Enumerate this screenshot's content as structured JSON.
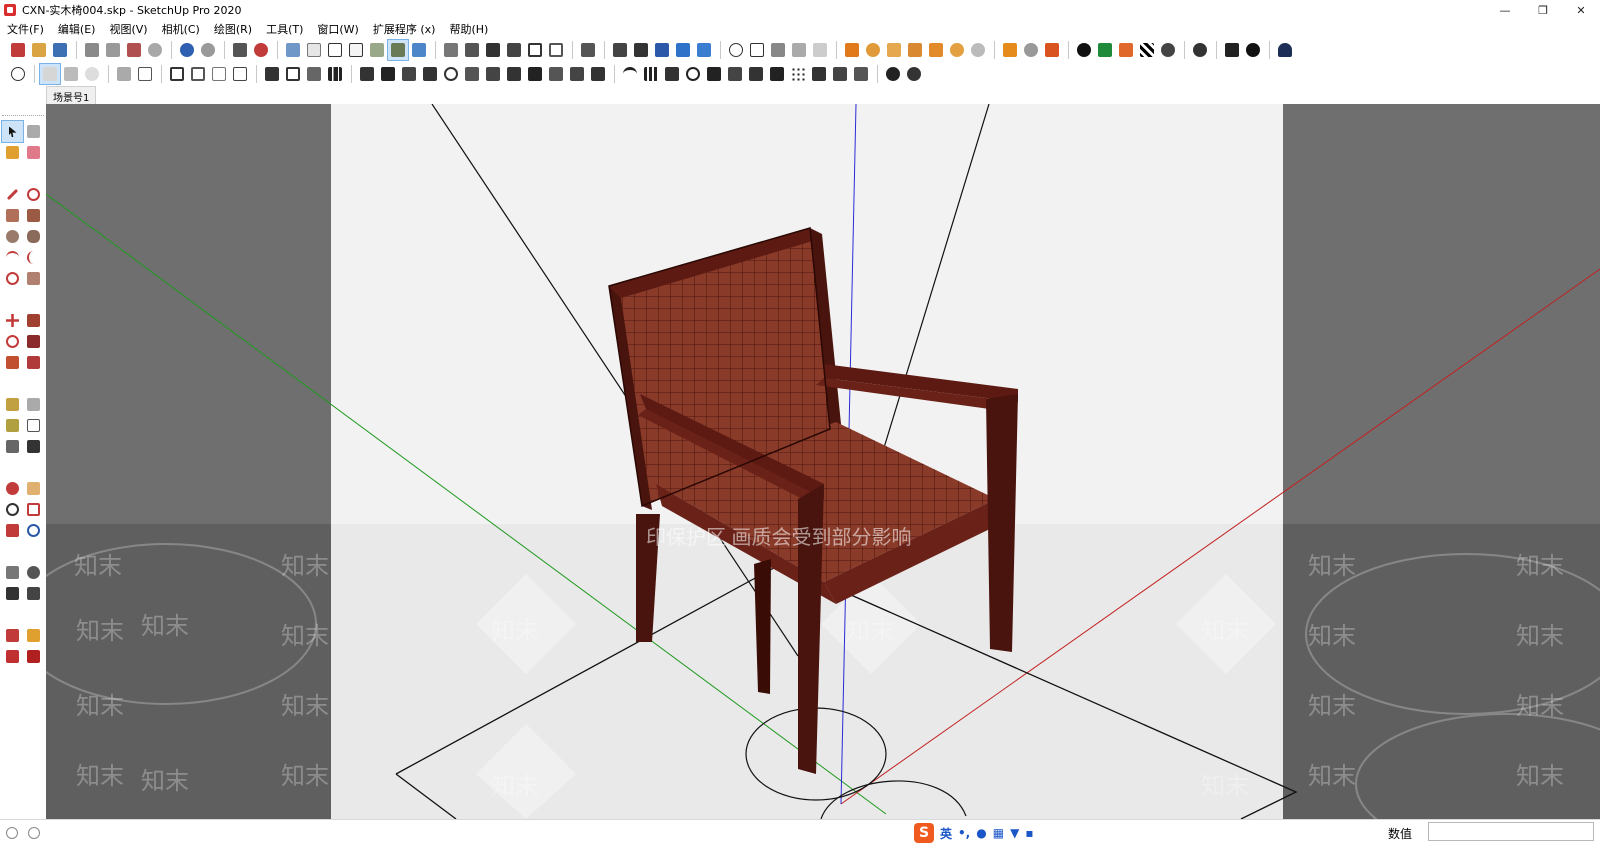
{
  "window": {
    "title": "CXN-实木椅004.skp - SketchUp Pro 2020",
    "minimize_glyph": "—",
    "maximize_glyph": "❐",
    "close_glyph": "✕"
  },
  "menu": [
    "文件(F)",
    "编辑(E)",
    "视图(V)",
    "相机(C)",
    "绘图(R)",
    "工具(T)",
    "窗口(W)",
    "扩展程序 (x)",
    "帮助(H)"
  ],
  "scene_tabs": [
    "场景号1"
  ],
  "watermark": {
    "banner": "印保护区  画质会受到部分影响",
    "brand": "知末"
  },
  "status": {
    "ime_logo": "S",
    "ime_lang": "英",
    "value_label": "数值",
    "value_input": ""
  },
  "colors": {
    "sky": "#f2f2f2",
    "ground": "#e9e9e9",
    "outside": "#6f6f6f",
    "chair_fabric": "#8a3a28",
    "chair_wood": "#5c1a12",
    "axis_red": "#c22020",
    "axis_green": "#1e9a1e",
    "axis_blue": "#2b2bd6",
    "active_tool": "#cde3f7"
  }
}
